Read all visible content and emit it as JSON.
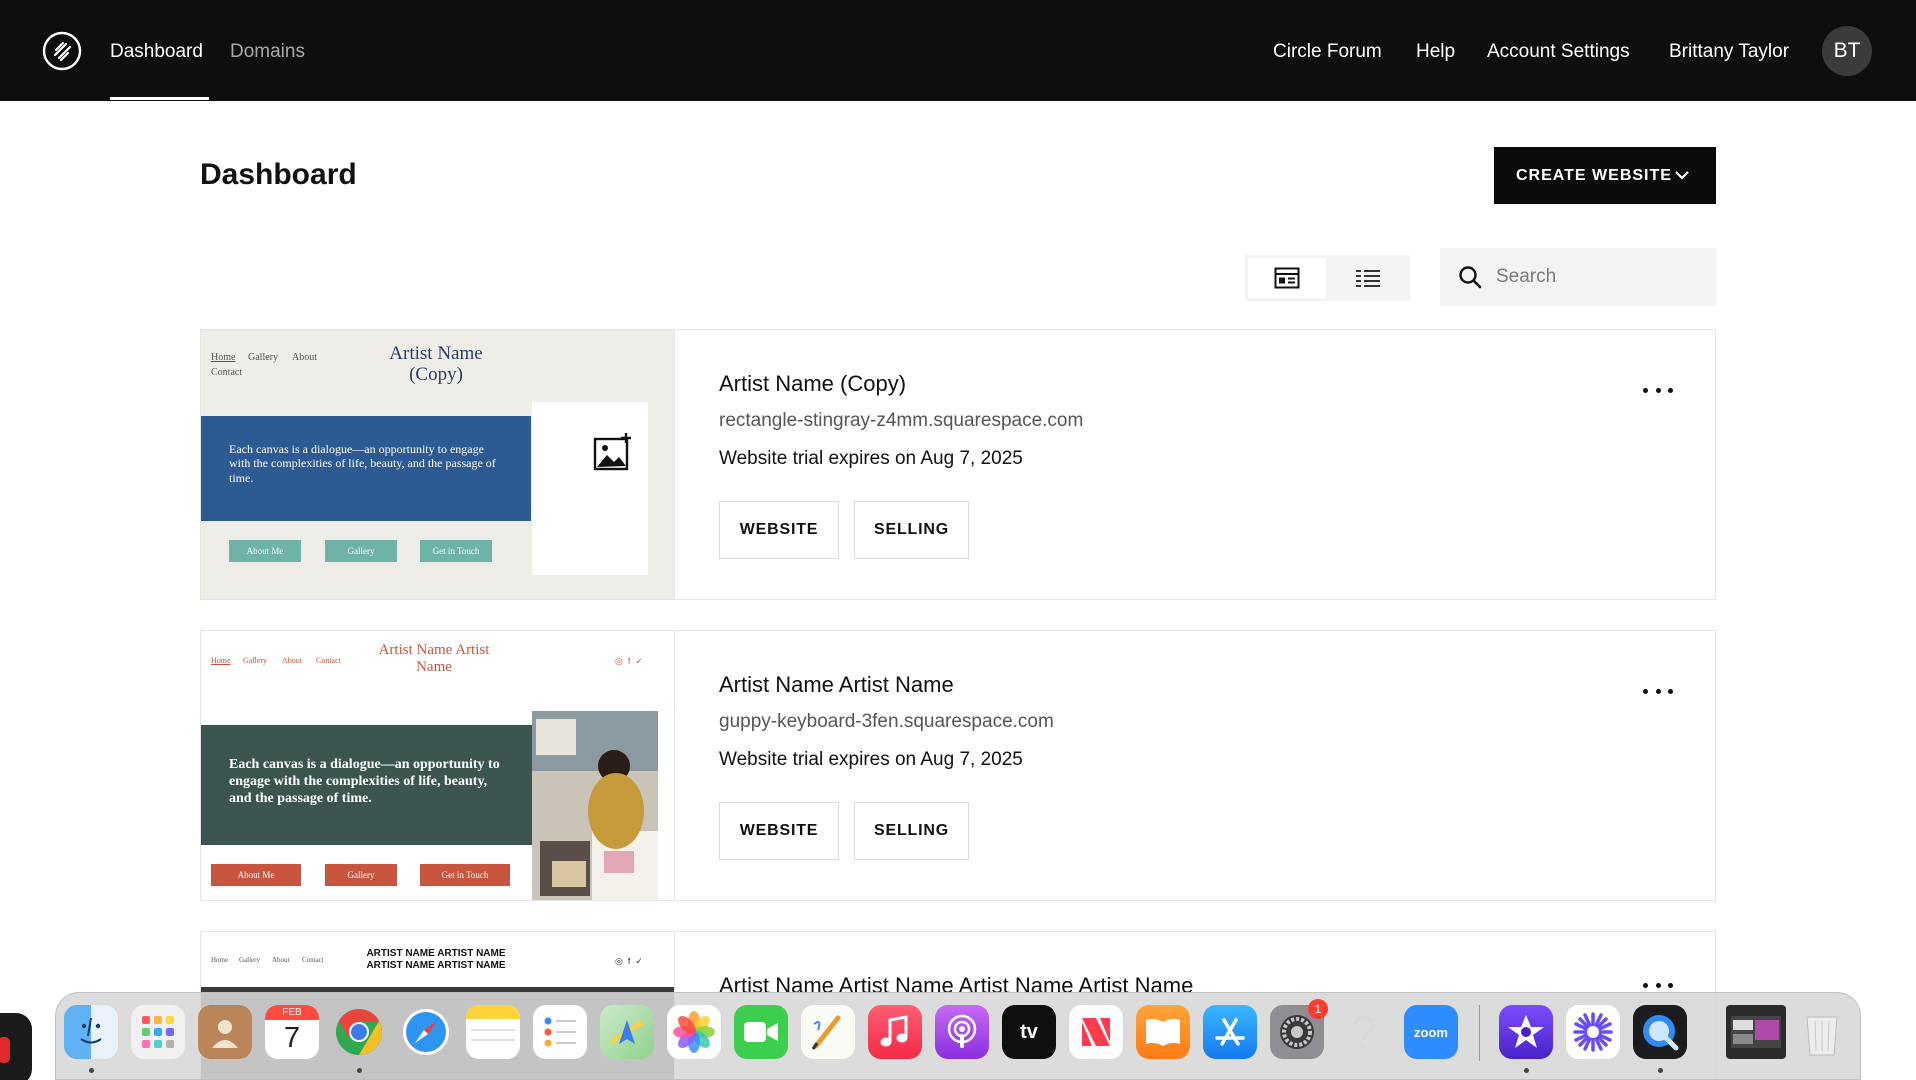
{
  "topnav": {
    "left_links": [
      "Dashboard",
      "Domains"
    ],
    "right_links": [
      "Circle Forum",
      "Help",
      "Account Settings"
    ],
    "user_name": "Brittany Taylor",
    "avatar_initials": "BT"
  },
  "page": {
    "title": "Dashboard",
    "create_button": "CREATE WEBSITE",
    "search_placeholder": "Search",
    "active_view": "grid"
  },
  "sites": [
    {
      "title": "Artist Name (Copy)",
      "url": "rectangle-stingray-z4mm.squarespace.com",
      "trial": "Website trial expires on Aug 7, 2025",
      "buttons": [
        "WEBSITE",
        "SELLING"
      ],
      "preview": {
        "nav": [
          "Home",
          "Gallery",
          "About",
          "Contact"
        ],
        "title": "Artist Name (Copy)",
        "hero_text": "Each canvas is a dialogue—an opportunity to engage with the complexities of life, beauty, and the passage of time.",
        "buttons": [
          "About Me",
          "Gallery",
          "Get in Touch"
        ],
        "accent": "#2e5a94",
        "button_color": "#6fb3a8"
      }
    },
    {
      "title": "Artist Name Artist Name",
      "url": "guppy-keyboard-3fen.squarespace.com",
      "trial": "Website trial expires on Aug 7, 2025",
      "buttons": [
        "WEBSITE",
        "SELLING"
      ],
      "preview": {
        "nav": [
          "Home",
          "Gallery",
          "About",
          "Contact"
        ],
        "title": "Artist Name Artist Name",
        "hero_text": "Each canvas is a dialogue—an opportunity to engage with the complexities of life, beauty, and the passage of time.",
        "buttons": [
          "About Me",
          "Gallery",
          "Get in Touch"
        ],
        "accent": "#3d5550",
        "button_color": "#c8553d"
      }
    },
    {
      "title": "Artist Name Artist Name Artist Name Artist Name",
      "preview": {
        "nav": [
          "Home",
          "Gallery",
          "About",
          "Contact"
        ],
        "title_line1": "ARTIST NAME ARTIST NAME",
        "title_line2": "ARTIST NAME ARTIST NAME"
      }
    }
  ],
  "dock": {
    "apps": [
      "finder",
      "launchpad",
      "contacts",
      "calendar",
      "chrome",
      "safari",
      "notes",
      "reminders",
      "maps",
      "photos",
      "facetime",
      "freeform",
      "music",
      "podcasts",
      "tv",
      "news",
      "books",
      "app-store",
      "system-settings",
      "help",
      "zoom",
      "imovie",
      "perplexity",
      "quicktime",
      "screenshot",
      "trash"
    ],
    "calendar_month": "FEB",
    "calendar_day": "7",
    "tv_label": "tv",
    "zoom_label": "zoom",
    "settings_badge": "1"
  }
}
